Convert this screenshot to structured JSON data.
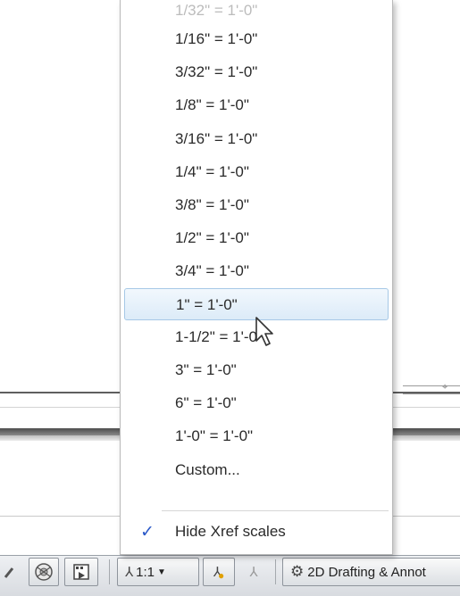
{
  "scale_menu": {
    "items": [
      {
        "label": "1/32\" = 1'-0\"",
        "state": "clipped"
      },
      {
        "label": "1/16\" = 1'-0\""
      },
      {
        "label": "3/32\" = 1'-0\""
      },
      {
        "label": "1/8\" = 1'-0\""
      },
      {
        "label": "3/16\" = 1'-0\""
      },
      {
        "label": "1/4\" = 1'-0\""
      },
      {
        "label": "3/8\" = 1'-0\""
      },
      {
        "label": "1/2\" = 1'-0\""
      },
      {
        "label": "3/4\" = 1'-0\""
      },
      {
        "label": "1\" = 1'-0\"",
        "state": "hover"
      },
      {
        "label": "1-1/2\" = 1'-0\""
      },
      {
        "label": "3\" = 1'-0\""
      },
      {
        "label": "6\" = 1'-0\""
      },
      {
        "label": "1'-0\" = 1'-0\""
      },
      {
        "label": "Custom..."
      }
    ],
    "hide_xref": {
      "label": "Hide Xref scales",
      "checked": true
    }
  },
  "statusbar": {
    "annotation_scale": "1:1",
    "workspace": "2D Drafting & Annot",
    "icons": [
      "zoom-icon",
      "steering-wheel-icon",
      "show-motion-icon",
      "annotation-scale-icon",
      "annotation-visibility-icon",
      "auto-scale-icon",
      "workspace-gear-icon"
    ]
  },
  "colors": {
    "hover_fill": "#dcebf8",
    "hover_border": "#a6c8e6",
    "check": "#2a58c8"
  }
}
